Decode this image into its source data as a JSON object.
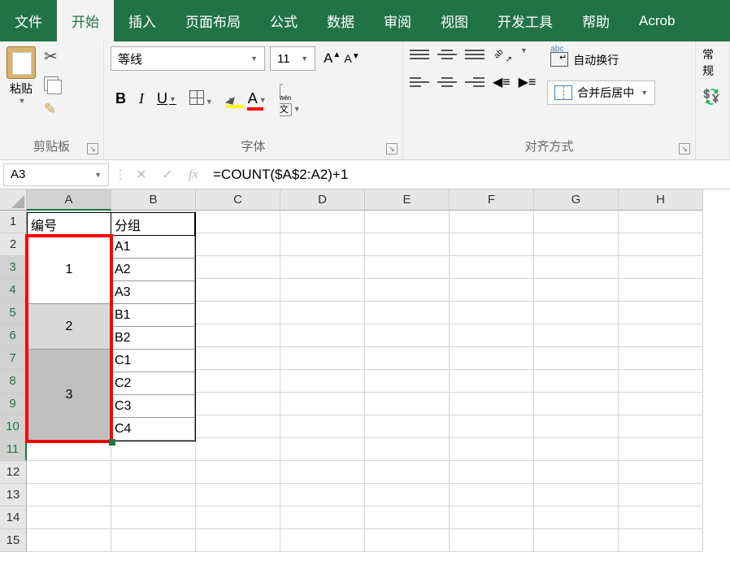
{
  "tabs": {
    "file": "文件",
    "home": "开始",
    "insert": "插入",
    "layout": "页面布局",
    "formulas": "公式",
    "data": "数据",
    "review": "审阅",
    "view": "视图",
    "developer": "开发工具",
    "help": "帮助",
    "acrobat": "Acrob"
  },
  "ribbon": {
    "paste_label": "粘贴",
    "clipboard_group": "剪贴板",
    "font_name": "等线",
    "font_size": "11",
    "font_group": "字体",
    "wrap_label": "自动换行",
    "merge_label": "合并后居中",
    "align_group": "对齐方式",
    "number_style": "常规",
    "wen": "文",
    "wen_top": "wén",
    "abc": "abc"
  },
  "namebox": "A3",
  "formula": "=COUNT($A$2:A2)+1",
  "columns": [
    "A",
    "B",
    "C",
    "D",
    "E",
    "F",
    "G",
    "H"
  ],
  "table": {
    "header_a": "编号",
    "header_b": "分组",
    "group1": "1",
    "group2": "2",
    "group3": "3",
    "b": [
      "A1",
      "A2",
      "A3",
      "B1",
      "B2",
      "C1",
      "C2",
      "C3",
      "C4"
    ]
  }
}
